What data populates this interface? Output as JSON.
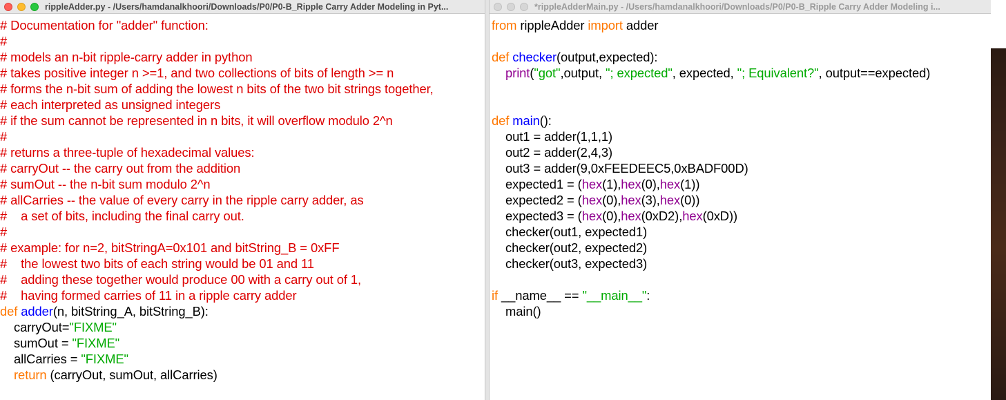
{
  "left_window": {
    "title": "rippleAdder.py - /Users/hamdanalkhoori/Downloads/P0/P0-B_Ripple Carry Adder Modeling in Pyt...",
    "lines": [
      [
        [
          "cmt",
          "# Documentation for \"adder\" function:"
        ]
      ],
      [
        [
          "cmt",
          "#"
        ]
      ],
      [
        [
          "cmt",
          "# models an n-bit ripple-carry adder in python"
        ]
      ],
      [
        [
          "cmt",
          "# takes positive integer n >=1, and two collections of bits of length >= n"
        ]
      ],
      [
        [
          "cmt",
          "# forms the n-bit sum of adding the lowest n bits of the two bit strings together,"
        ]
      ],
      [
        [
          "cmt",
          "# each interpreted as unsigned integers"
        ]
      ],
      [
        [
          "cmt",
          "# if the sum cannot be represented in n bits, it will overflow modulo 2^n"
        ]
      ],
      [
        [
          "cmt",
          "#"
        ]
      ],
      [
        [
          "cmt",
          "# returns a three-tuple of hexadecimal values:"
        ]
      ],
      [
        [
          "cmt",
          "# carryOut -- the carry out from the addition"
        ]
      ],
      [
        [
          "cmt",
          "# sumOut -- the n-bit sum modulo 2^n"
        ]
      ],
      [
        [
          "cmt",
          "# allCarries -- the value of every carry in the ripple carry adder, as"
        ]
      ],
      [
        [
          "cmt",
          "#    a set of bits, including the final carry out."
        ]
      ],
      [
        [
          "cmt",
          "#"
        ]
      ],
      [
        [
          "cmt",
          "# example: for n=2, bitStringA=0x101 and bitString_B = 0xFF"
        ]
      ],
      [
        [
          "cmt",
          "#    the lowest two bits of each string would be 01 and 11"
        ]
      ],
      [
        [
          "cmt",
          "#    adding these together would produce 00 with a carry out of 1,"
        ]
      ],
      [
        [
          "cmt",
          "#    having formed carries of 11 in a ripple carry adder"
        ]
      ],
      [
        [
          "kw",
          "def "
        ],
        [
          "def",
          "adder"
        ],
        [
          "",
          "(n, bitString_A, bitString_B):"
        ]
      ],
      [
        [
          "",
          "    carryOut="
        ],
        [
          "str",
          "\"FIXME\""
        ]
      ],
      [
        [
          "",
          "    sumOut = "
        ],
        [
          "str",
          "\"FIXME\""
        ]
      ],
      [
        [
          "",
          "    allCarries = "
        ],
        [
          "str",
          "\"FIXME\""
        ]
      ],
      [
        [
          "kw",
          "    return"
        ],
        [
          "",
          " (carryOut, sumOut, allCarries)"
        ]
      ]
    ]
  },
  "right_window": {
    "title": "*rippleAdderMain.py - /Users/hamdanalkhoori/Downloads/P0/P0-B_Ripple Carry Adder Modeling i...",
    "lines": [
      [
        [
          "kw",
          "from"
        ],
        [
          "",
          " rippleAdder "
        ],
        [
          "kw",
          "import"
        ],
        [
          "",
          " adder"
        ]
      ],
      [
        [
          "",
          ""
        ]
      ],
      [
        [
          "kw",
          "def "
        ],
        [
          "def",
          "checker"
        ],
        [
          "",
          "(output,expected):"
        ]
      ],
      [
        [
          "bi",
          "    print"
        ],
        [
          "",
          "("
        ],
        [
          "str",
          "\"got\""
        ],
        [
          "",
          ",output, "
        ],
        [
          "str",
          "\"; expected\""
        ],
        [
          "",
          ", expected, "
        ],
        [
          "str",
          "\"; Equivalent?\""
        ],
        [
          "",
          ", output==expected)"
        ]
      ],
      [
        [
          "",
          ""
        ]
      ],
      [
        [
          "",
          ""
        ]
      ],
      [
        [
          "kw",
          "def "
        ],
        [
          "def",
          "main"
        ],
        [
          "",
          "():"
        ]
      ],
      [
        [
          "",
          "    out1 = adder(1,1,1)"
        ]
      ],
      [
        [
          "",
          "    out2 = adder(2,4,3)"
        ]
      ],
      [
        [
          "",
          "    out3 = adder(9,0xFEEDEEC5,0xBADF00D)"
        ]
      ],
      [
        [
          "",
          "    expected1 = ("
        ],
        [
          "bi",
          "hex"
        ],
        [
          "",
          "(1),"
        ],
        [
          "bi",
          "hex"
        ],
        [
          "",
          "(0),"
        ],
        [
          "bi",
          "hex"
        ],
        [
          "",
          "(1))"
        ]
      ],
      [
        [
          "",
          "    expected2 = ("
        ],
        [
          "bi",
          "hex"
        ],
        [
          "",
          "(0),"
        ],
        [
          "bi",
          "hex"
        ],
        [
          "",
          "(3),"
        ],
        [
          "bi",
          "hex"
        ],
        [
          "",
          "(0))"
        ]
      ],
      [
        [
          "",
          "    expected3 = ("
        ],
        [
          "bi",
          "hex"
        ],
        [
          "",
          "(0),"
        ],
        [
          "bi",
          "hex"
        ],
        [
          "",
          "(0xD2),"
        ],
        [
          "bi",
          "hex"
        ],
        [
          "",
          "(0xD))"
        ]
      ],
      [
        [
          "",
          "    checker(out1, expected1)"
        ]
      ],
      [
        [
          "",
          "    checker(out2, expected2)"
        ]
      ],
      [
        [
          "",
          "    checker(out3, expected3)"
        ]
      ],
      [
        [
          "",
          ""
        ]
      ],
      [
        [
          "kw",
          "if"
        ],
        [
          "",
          " __name__ == "
        ],
        [
          "str",
          "\"__main__\""
        ],
        [
          "",
          ":"
        ]
      ],
      [
        [
          "",
          "    main()"
        ]
      ]
    ]
  }
}
